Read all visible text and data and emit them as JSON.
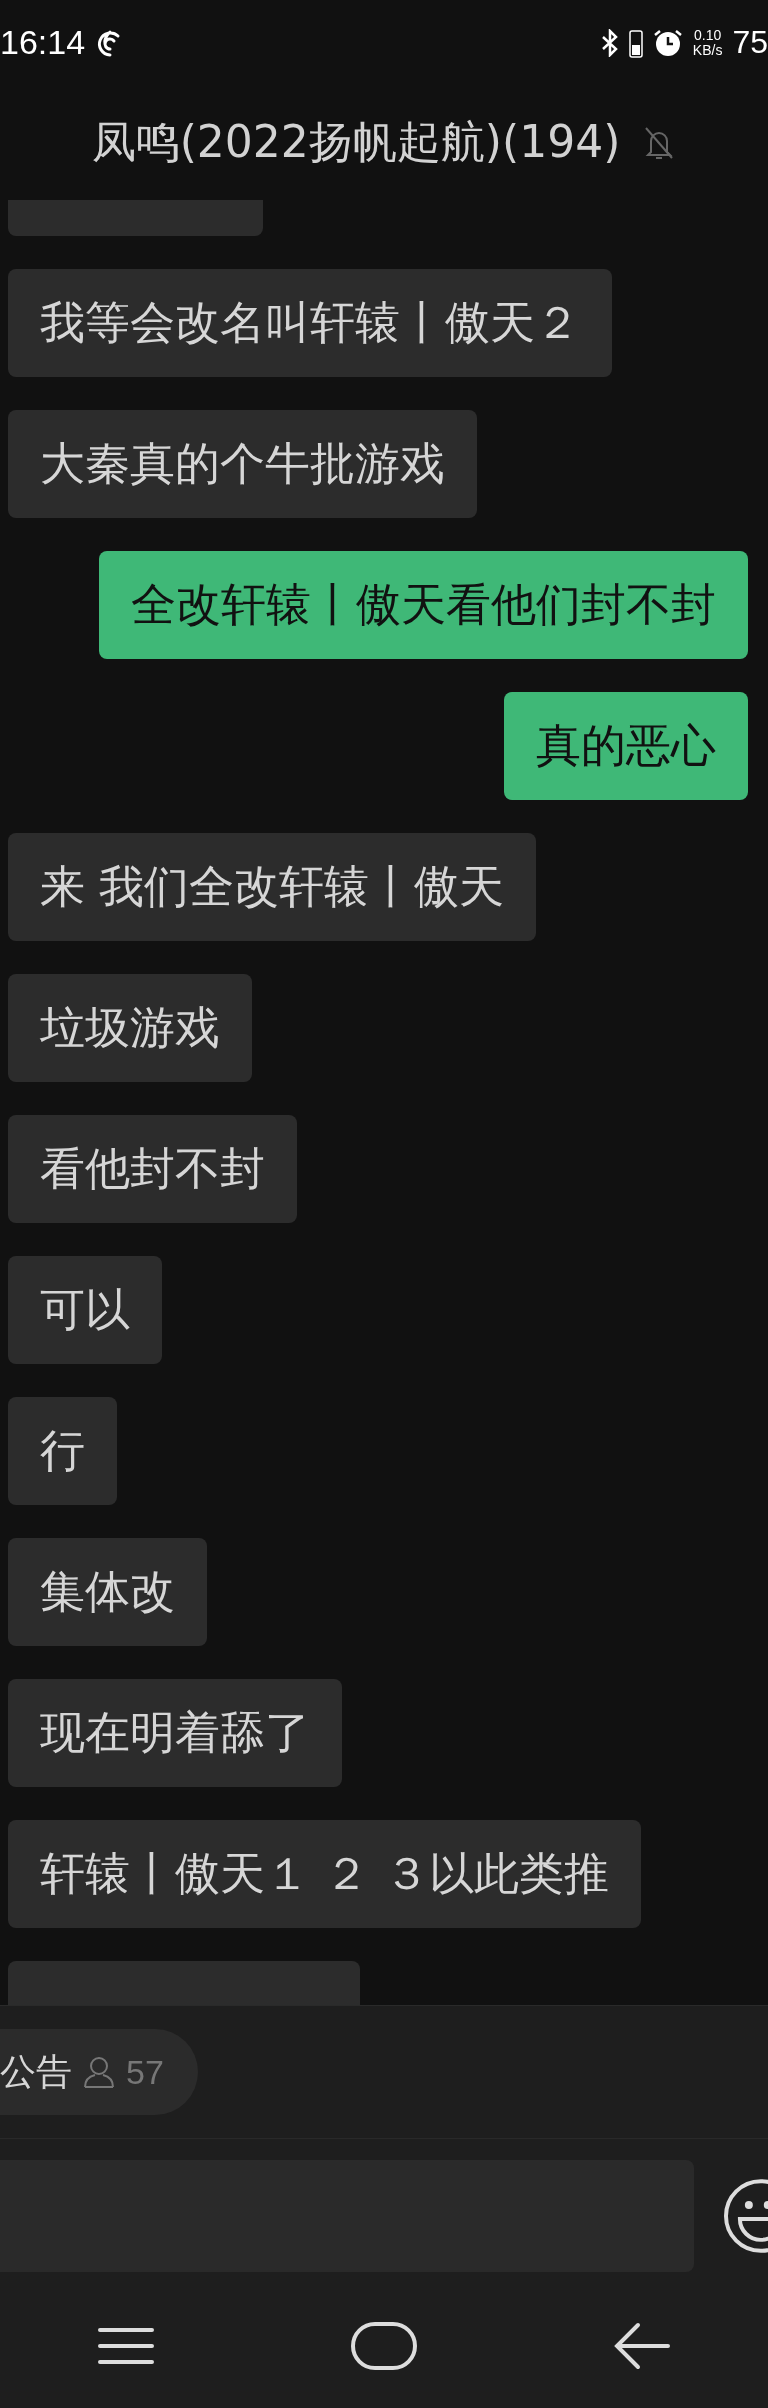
{
  "status_bar": {
    "time": "16:14",
    "net_speed": "0.10",
    "net_unit": "KB/s",
    "battery": "75"
  },
  "header": {
    "title": "凤鸣(2022扬帆起航)(194)",
    "muted": true
  },
  "messages": [
    {
      "kind": "cut"
    },
    {
      "kind": "received",
      "text": "我等会改名叫轩辕丨傲天２"
    },
    {
      "kind": "received",
      "text": "大秦真的个牛批游戏"
    },
    {
      "kind": "sent",
      "text": "全改轩辕丨傲天看他们封不封"
    },
    {
      "kind": "sent",
      "text": "真的恶心"
    },
    {
      "kind": "received",
      "text": "来 我们全改轩辕丨傲天"
    },
    {
      "kind": "received",
      "text": "垃圾游戏"
    },
    {
      "kind": "received",
      "text": "看他封不封"
    },
    {
      "kind": "received",
      "text": "可以"
    },
    {
      "kind": "received",
      "text": "行"
    },
    {
      "kind": "received",
      "text": "集体改"
    },
    {
      "kind": "received",
      "text": "现在明着舔了"
    },
    {
      "kind": "received",
      "text": "轩辕丨傲天１ ２ ３以此类推"
    },
    {
      "kind": "cut"
    }
  ],
  "notice": {
    "label": "公告",
    "count": "57"
  }
}
